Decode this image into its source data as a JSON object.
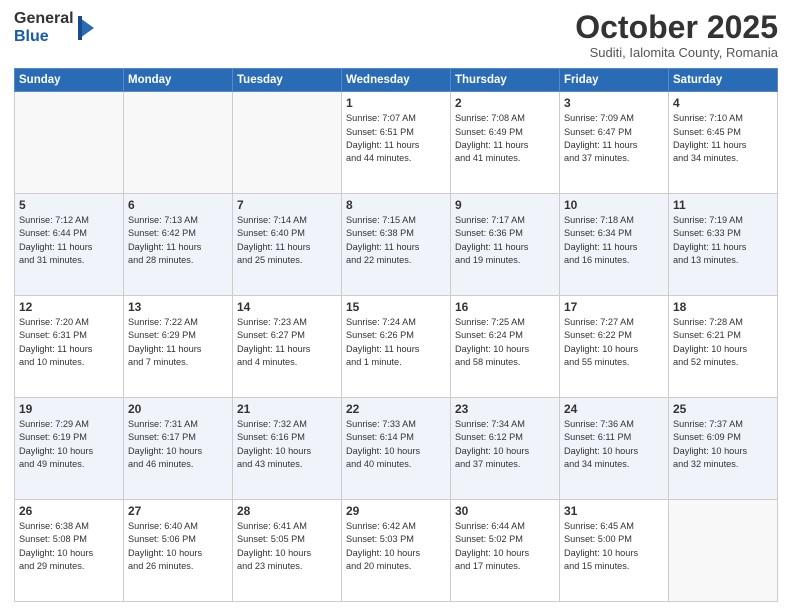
{
  "logo": {
    "general": "General",
    "blue": "Blue"
  },
  "title": "October 2025",
  "subtitle": "Suditi, Ialomita County, Romania",
  "weekdays": [
    "Sunday",
    "Monday",
    "Tuesday",
    "Wednesday",
    "Thursday",
    "Friday",
    "Saturday"
  ],
  "weeks": [
    [
      {
        "day": "",
        "info": ""
      },
      {
        "day": "",
        "info": ""
      },
      {
        "day": "",
        "info": ""
      },
      {
        "day": "1",
        "info": "Sunrise: 7:07 AM\nSunset: 6:51 PM\nDaylight: 11 hours\nand 44 minutes."
      },
      {
        "day": "2",
        "info": "Sunrise: 7:08 AM\nSunset: 6:49 PM\nDaylight: 11 hours\nand 41 minutes."
      },
      {
        "day": "3",
        "info": "Sunrise: 7:09 AM\nSunset: 6:47 PM\nDaylight: 11 hours\nand 37 minutes."
      },
      {
        "day": "4",
        "info": "Sunrise: 7:10 AM\nSunset: 6:45 PM\nDaylight: 11 hours\nand 34 minutes."
      }
    ],
    [
      {
        "day": "5",
        "info": "Sunrise: 7:12 AM\nSunset: 6:44 PM\nDaylight: 11 hours\nand 31 minutes."
      },
      {
        "day": "6",
        "info": "Sunrise: 7:13 AM\nSunset: 6:42 PM\nDaylight: 11 hours\nand 28 minutes."
      },
      {
        "day": "7",
        "info": "Sunrise: 7:14 AM\nSunset: 6:40 PM\nDaylight: 11 hours\nand 25 minutes."
      },
      {
        "day": "8",
        "info": "Sunrise: 7:15 AM\nSunset: 6:38 PM\nDaylight: 11 hours\nand 22 minutes."
      },
      {
        "day": "9",
        "info": "Sunrise: 7:17 AM\nSunset: 6:36 PM\nDaylight: 11 hours\nand 19 minutes."
      },
      {
        "day": "10",
        "info": "Sunrise: 7:18 AM\nSunset: 6:34 PM\nDaylight: 11 hours\nand 16 minutes."
      },
      {
        "day": "11",
        "info": "Sunrise: 7:19 AM\nSunset: 6:33 PM\nDaylight: 11 hours\nand 13 minutes."
      }
    ],
    [
      {
        "day": "12",
        "info": "Sunrise: 7:20 AM\nSunset: 6:31 PM\nDaylight: 11 hours\nand 10 minutes."
      },
      {
        "day": "13",
        "info": "Sunrise: 7:22 AM\nSunset: 6:29 PM\nDaylight: 11 hours\nand 7 minutes."
      },
      {
        "day": "14",
        "info": "Sunrise: 7:23 AM\nSunset: 6:27 PM\nDaylight: 11 hours\nand 4 minutes."
      },
      {
        "day": "15",
        "info": "Sunrise: 7:24 AM\nSunset: 6:26 PM\nDaylight: 11 hours\nand 1 minute."
      },
      {
        "day": "16",
        "info": "Sunrise: 7:25 AM\nSunset: 6:24 PM\nDaylight: 10 hours\nand 58 minutes."
      },
      {
        "day": "17",
        "info": "Sunrise: 7:27 AM\nSunset: 6:22 PM\nDaylight: 10 hours\nand 55 minutes."
      },
      {
        "day": "18",
        "info": "Sunrise: 7:28 AM\nSunset: 6:21 PM\nDaylight: 10 hours\nand 52 minutes."
      }
    ],
    [
      {
        "day": "19",
        "info": "Sunrise: 7:29 AM\nSunset: 6:19 PM\nDaylight: 10 hours\nand 49 minutes."
      },
      {
        "day": "20",
        "info": "Sunrise: 7:31 AM\nSunset: 6:17 PM\nDaylight: 10 hours\nand 46 minutes."
      },
      {
        "day": "21",
        "info": "Sunrise: 7:32 AM\nSunset: 6:16 PM\nDaylight: 10 hours\nand 43 minutes."
      },
      {
        "day": "22",
        "info": "Sunrise: 7:33 AM\nSunset: 6:14 PM\nDaylight: 10 hours\nand 40 minutes."
      },
      {
        "day": "23",
        "info": "Sunrise: 7:34 AM\nSunset: 6:12 PM\nDaylight: 10 hours\nand 37 minutes."
      },
      {
        "day": "24",
        "info": "Sunrise: 7:36 AM\nSunset: 6:11 PM\nDaylight: 10 hours\nand 34 minutes."
      },
      {
        "day": "25",
        "info": "Sunrise: 7:37 AM\nSunset: 6:09 PM\nDaylight: 10 hours\nand 32 minutes."
      }
    ],
    [
      {
        "day": "26",
        "info": "Sunrise: 6:38 AM\nSunset: 5:08 PM\nDaylight: 10 hours\nand 29 minutes."
      },
      {
        "day": "27",
        "info": "Sunrise: 6:40 AM\nSunset: 5:06 PM\nDaylight: 10 hours\nand 26 minutes."
      },
      {
        "day": "28",
        "info": "Sunrise: 6:41 AM\nSunset: 5:05 PM\nDaylight: 10 hours\nand 23 minutes."
      },
      {
        "day": "29",
        "info": "Sunrise: 6:42 AM\nSunset: 5:03 PM\nDaylight: 10 hours\nand 20 minutes."
      },
      {
        "day": "30",
        "info": "Sunrise: 6:44 AM\nSunset: 5:02 PM\nDaylight: 10 hours\nand 17 minutes."
      },
      {
        "day": "31",
        "info": "Sunrise: 6:45 AM\nSunset: 5:00 PM\nDaylight: 10 hours\nand 15 minutes."
      },
      {
        "day": "",
        "info": ""
      }
    ]
  ]
}
